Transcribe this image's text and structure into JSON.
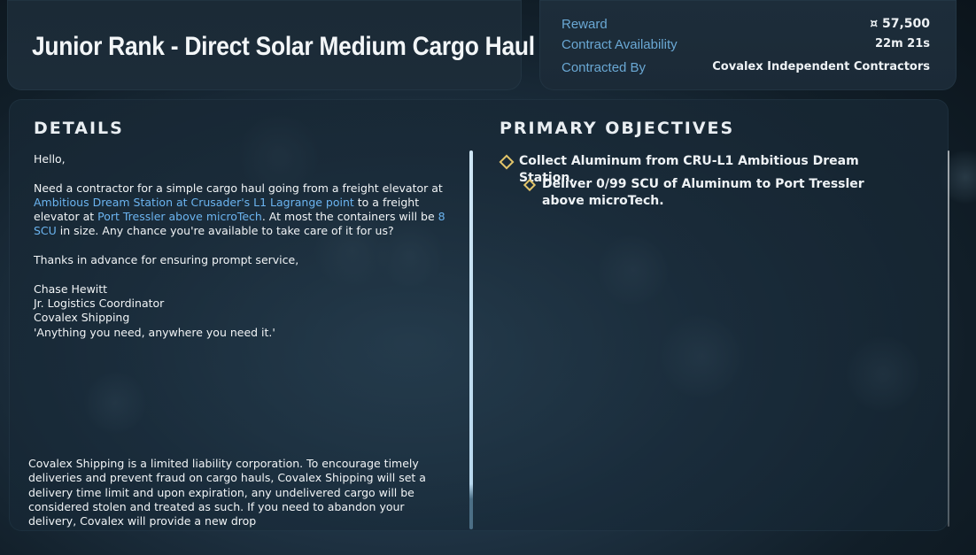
{
  "contract": {
    "title": "Junior Rank - Direct Solar Medium Cargo Haul"
  },
  "info": {
    "reward_label": "Reward",
    "reward_value": "¤ 57,500",
    "availability_label": "Contract Availability",
    "availability_value": "22m 21s",
    "contracted_by_label": "Contracted By",
    "contracted_by_value": "Covalex Independent Contractors"
  },
  "details": {
    "heading": "DETAILS",
    "greeting": "Hello,",
    "p1_a": "Need a contractor for a simple cargo haul going from a freight elevator at ",
    "p1_link1": "Ambitious Dream Station at Crusader's L1 Lagrange point",
    "p1_b": " to a freight elevator at ",
    "p1_link2": "Port Tressler above microTech",
    "p1_c": ". At most the containers will be ",
    "p1_link3": "8 SCU",
    "p1_d": " in size. Any chance you're available to take care of it for us?",
    "thanks": "Thanks in advance for ensuring prompt service,",
    "sig_name": "Chase Hewitt",
    "sig_title": "Jr. Logistics Coordinator",
    "sig_company": "Covalex Shipping",
    "sig_motto": "'Anything you need, anywhere you need it.'",
    "disclaimer": "Covalex Shipping is a limited liability corporation. To encourage timely deliveries and prevent fraud on cargo hauls, Covalex Shipping will set a delivery time limit and upon expiration, any undelivered cargo will be considered stolen and treated as such. If you need to abandon your delivery, Covalex will provide a new drop"
  },
  "objectives": {
    "heading": "PRIMARY OBJECTIVES",
    "primary": "Collect Aluminum from CRU-L1 Ambitious Dream Station.",
    "sub": "Deliver 0/99 SCU of Aluminum to Port Tressler above microTech."
  },
  "colors": {
    "link": "#6bb4f0",
    "label": "#6aa8d4",
    "objective_marker": "#e2c46a"
  }
}
